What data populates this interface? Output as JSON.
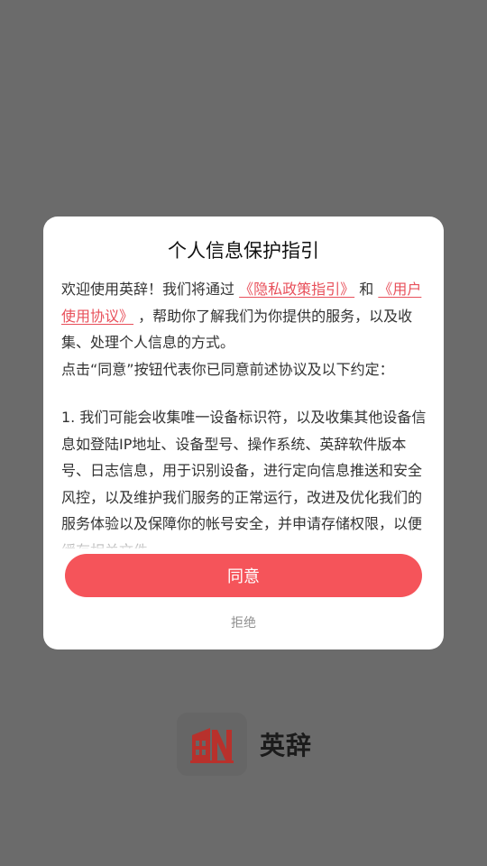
{
  "dialog": {
    "title": "个人信息保护指引",
    "intro_prefix": "欢迎使用英辞！我们将通过",
    "privacy_link": "《隐私政策指引》",
    "and_text": "和",
    "user_agreement_link": "《用户使用协议》",
    "intro_suffix": "，帮助你了解我们为你提供的服务，以及收集、处理个人信息的方式。",
    "agree_notice": "点击“同意”按钮代表你已同意前述协议及以下约定：",
    "clause_1": "1. 我们可能会收集唯一设备标识符，以及收集其他设备信息如登陆IP地址、设备型号、操作系统、英辞软件版本号、日志信息，用于识别设备，进行定向信息推送和安全风控，以及维护我们服务的正常运行，改进及优化我们的服务体验以及保障你的帐号安全，并申请存储权限，以便缓存相关文件。",
    "agree_label": "同意",
    "reject_label": "拒绝"
  },
  "brand": {
    "name": "英辞",
    "logo_icon": "ying-ci-logo"
  },
  "colors": {
    "accent": "#f5545a",
    "link": "#e8505b",
    "overlay": "#6b6b6b",
    "logo_red": "#b8312c"
  }
}
